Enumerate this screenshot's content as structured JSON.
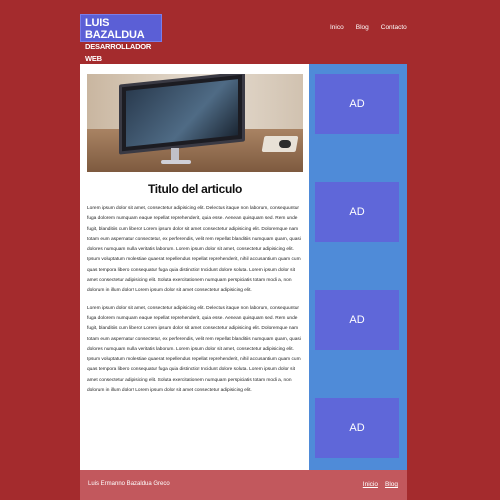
{
  "header": {
    "logo_line1": "LUIS BAZALDUA",
    "logo_line2": "DESARROLLADOR WEB",
    "nav": [
      "Inico",
      "Blog",
      "Contacto"
    ]
  },
  "article": {
    "title": "Titulo del articulo",
    "paragraphs": [
      "Lorem ipsum dolor sit amet, consectetur adipisicing elit. Delectus itaque non laborum, consequuntur fuga dolorem numquam eaque repellat reprehenderit, quia esse. Aenean quisquam sed. Rem unde fugit, blanditiis cum libero! Lorem ipsum dolor sit amet consectetur adipisicing elit. Doloremque nam totam eum aspernatur consectetur, ex perferendis, velit rem repellat blanditiis numquam quam, quasi dolores numquam nulla veritatis laborum. Lorem ipsum dolor sit amet, consectetur adipisicing elit. Ipsum voluptatum molestiae quaerat repellendus repellat reprehenderit, nihil accusantium quam cum quas tempora libero consequatur fuga quia distinctio! Incidunt dolore soluta. Lorem ipsum dolor sit amet consectetur adipisicing elit. Soluta exercitationem numquam perspiciatis totam modi a, non dolorum in illum dolor! Lorem ipsum dolor sit amet consectetur adipisicing elit.",
      "Lorem ipsum dolor sit amet, consectetur adipisicing elit. Delectus itaque non laborum, consequuntur fuga dolorem numquam eaque repellat reprehenderit, quia esse. Aenean quisquam sed. Rem unde fugit, blanditiis cum libero! Lorem ipsum dolor sit amet consectetur adipisicing elit. Doloremque nam totam eum aspernatur consectetur, ex perferendis, velit rem repellat blanditiis numquam quam, quasi dolores numquam nulla veritatis laborum. Lorem ipsum dolor sit amet, consectetur adipisicing elit. Ipsum voluptatum molestiae quaerat repellendus repellat reprehenderit, nihil accusantium quam cum quas tempora libero consequatur fuga quia distinctio! Incidunt dolore soluta. Lorem ipsum dolor sit amet consectetur adipisicing elit. Soluta exercitationem numquam perspiciatis totam modi a, non dolorum in illum dolor! Lorem ipsum dolor sit amet consectetur adipisicing elit."
    ]
  },
  "sidebar": {
    "ads": [
      "AD",
      "AD",
      "AD",
      "AD"
    ]
  },
  "footer": {
    "copyright": "Luis Ermanno Bazaldua Greco",
    "links": [
      "Inicio",
      "Blog"
    ]
  },
  "colors": {
    "background": "#a42b2d",
    "logo": "#5b5fd6",
    "sidebar": "#4f8bd8",
    "ad": "#5f67d9",
    "footer": "#c2585d"
  }
}
